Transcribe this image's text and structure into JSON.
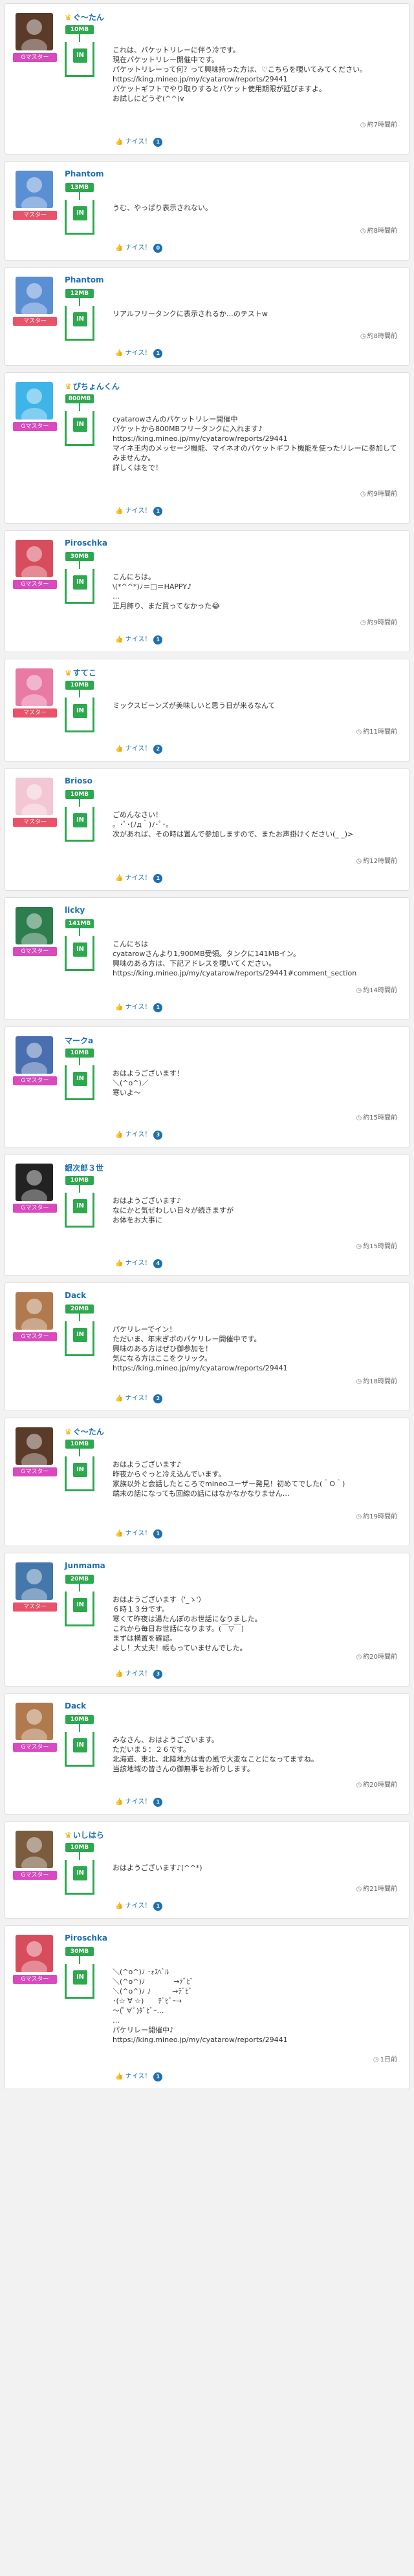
{
  "posts": [
    {
      "user": "ぐ〜たん",
      "crown": true,
      "rank": "Gマスター",
      "rank_class": "g",
      "amount": "10MB",
      "text": "これは、パケットリレーに伴う冷です。\n現在パケットリレー開催中です。\nパケットリレーって何？って興味持った方は、♡こちらを覗いてみてください。\nhttps://king.mineo.jp/my/cyatarow/reports/29441\nパケットギフトでやり取りするとパケット使用期限が延びますよ。\nお試しにどうぞ(^^)v",
      "likes": "1",
      "time": "約7時間前",
      "avatar": "#5a3b2a"
    },
    {
      "user": "Phantom",
      "crown": false,
      "rank": "マスター",
      "rank_class": "m",
      "amount": "13MB",
      "text": "うむ、やっぱり表示されない。",
      "likes": "0",
      "time": "約8時間前",
      "avatar": "#5b8fd4"
    },
    {
      "user": "Phantom",
      "crown": false,
      "rank": "マスター",
      "rank_class": "m",
      "amount": "12MB",
      "text": "リアルフリータンクに表示されるか…のテストw",
      "likes": "1",
      "time": "約8時間前",
      "avatar": "#5b8fd4"
    },
    {
      "user": "ぴちょんくん",
      "crown": true,
      "rank": "Gマスター",
      "rank_class": "g",
      "amount": "800MB",
      "text": "cyatarowさんのパケットリレー開催中\nパケットから800MBフリータンクに入れます♪\nhttps://king.mineo.jp/my/cyatarow/reports/29441\nマイネ王内のメッセージ機能、マイネオのパケットギフト機能を使ったリレーに参加してみませんか。\n詳しくはをで！",
      "likes": "1",
      "time": "約9時間前",
      "avatar": "#3fb4e8"
    },
    {
      "user": "Piroschka",
      "crown": false,
      "rank": "Gマスター",
      "rank_class": "g",
      "amount": "30MB",
      "text": "こんにちは。\n\\(*^^*)ﾉ＝□＝HAPPY♪\n…\n正月飾り、まだ買ってなかった😂",
      "likes": "1",
      "time": "約9時間前",
      "avatar": "#d84d5e"
    },
    {
      "user": "すてこ",
      "crown": true,
      "rank": "マスター",
      "rank_class": "m",
      "amount": "10MB",
      "text": "ミックスビーンズが美味しいと思う日が来るなんて",
      "likes": "2",
      "time": "約11時間前",
      "avatar": "#e87aa3"
    },
    {
      "user": "Brioso",
      "crown": false,
      "rank": "マスター",
      "rank_class": "m",
      "amount": "10MB",
      "text": "ごめんなさい！\n。･ﾟ･(ﾉд｀)ﾉ･ﾟ･。\n次があれば、その時は置んで参加しますので、またお声掛けください(_ _)>",
      "likes": "1",
      "time": "約12時間前",
      "avatar": "#f3c6d3"
    },
    {
      "user": "licky",
      "crown": false,
      "rank": "Gマスター",
      "rank_class": "g",
      "amount": "141MB",
      "text": "こんにちは\ncyatarowさんより1,900MB受領。タンクに141MBイン。\n興味のある方は、下記アドレスを覗いてください。https://king.mineo.jp/my/cyatarow/reports/29441#comment_section",
      "likes": "1",
      "time": "約14時間前",
      "avatar": "#2e7d4f"
    },
    {
      "user": "マークa",
      "crown": false,
      "rank": "Gマスター",
      "rank_class": "g",
      "amount": "10MB",
      "text": "おはようございます！\n＼(^o^)／\n寒いよ〜",
      "likes": "3",
      "time": "約15時間前",
      "avatar": "#4a6fb0"
    },
    {
      "user": "銀次郎３世",
      "crown": false,
      "rank": "Gマスター",
      "rank_class": "g",
      "amount": "10MB",
      "text": "おはようございます♪\nなにかと気ぜわしい日々が続きますが\nお体をお大事に",
      "likes": "4",
      "time": "約15時間前",
      "avatar": "#222222"
    },
    {
      "user": "Dack",
      "crown": false,
      "rank": "Gマスター",
      "rank_class": "g",
      "amount": "20MB",
      "text": "パケリレーでイン！\nただいま、年末ぎボのパケリレー開催中です。\n興味のある方はぜひ御参加を！\n気になる方はここをクリック。\nhttps://king.mineo.jp/my/cyatarow/reports/29441",
      "likes": "2",
      "time": "約18時間前",
      "avatar": "#b07a4e"
    },
    {
      "user": "ぐ〜たん",
      "crown": true,
      "rank": "Gマスター",
      "rank_class": "g",
      "amount": "10MB",
      "text": "おはようございます♪\n昨夜からぐっと冷え込んでいます。\n家族以外と会話したところでmineoユーザー発見！初めてでした(＾O＾)\n端末の話になっても回線の話にはなかなかなりません…",
      "likes": "1",
      "time": "約19時間前",
      "avatar": "#5a3b2a"
    },
    {
      "user": "Junmama",
      "crown": false,
      "rank": "マスター",
      "rank_class": "m",
      "amount": "20MB",
      "text": "おはようございます（'_ゝ'）\n６時１３分です。\n寒くて昨夜は湯たんぽのお世話になりました。\nこれから毎日お世話になります。(￣▽￣)\nまずは横置を確認。\nよし！大丈夫！帳もっていませんでした。",
      "likes": "3",
      "time": "約20時間前",
      "avatar": "#4477aa"
    },
    {
      "user": "Dack",
      "crown": false,
      "rank": "Gマスター",
      "rank_class": "g",
      "amount": "10MB",
      "text": "みなさん、おはようございます。\nただいま５：２６です。\n北海道、東北、北陸地方は雪の風で大変なことになってますね。\n当該地域の皆さんの御無事をお祈りします。",
      "likes": "1",
      "time": "約20時間前",
      "avatar": "#b07a4e"
    },
    {
      "user": "いしはら",
      "crown": true,
      "rank": "Gマスター",
      "rank_class": "g",
      "amount": "10MB",
      "text": "おはようございます♪(^^*)",
      "likes": "1",
      "time": "約21時間前",
      "avatar": "#7a5c3f"
    },
    {
      "user": "Piroschka",
      "crown": false,
      "rank": "Gマスター",
      "rank_class": "g",
      "amount": "30MB",
      "text": "＼(^o^)ﾉ ･ｫｽﾍﾞﾙ\n＼(^o^)ﾉ　　　　→ﾃﾞﾋﾞ\n＼(^o^)ﾉ ﾉ　　　→ﾃﾞﾋﾞ\n･(☆ ∀ ☆)　　ﾃﾞﾋﾞｰ→\n〜(ﾟ∀ﾟ)ﾀﾞﾋﾞｰ…\n…\nパケリレー開催中♪\nhttps://king.mineo.jp/my/cyatarow/reports/29441",
      "likes": "1",
      "time": "1日前",
      "avatar": "#d84d5e"
    }
  ]
}
